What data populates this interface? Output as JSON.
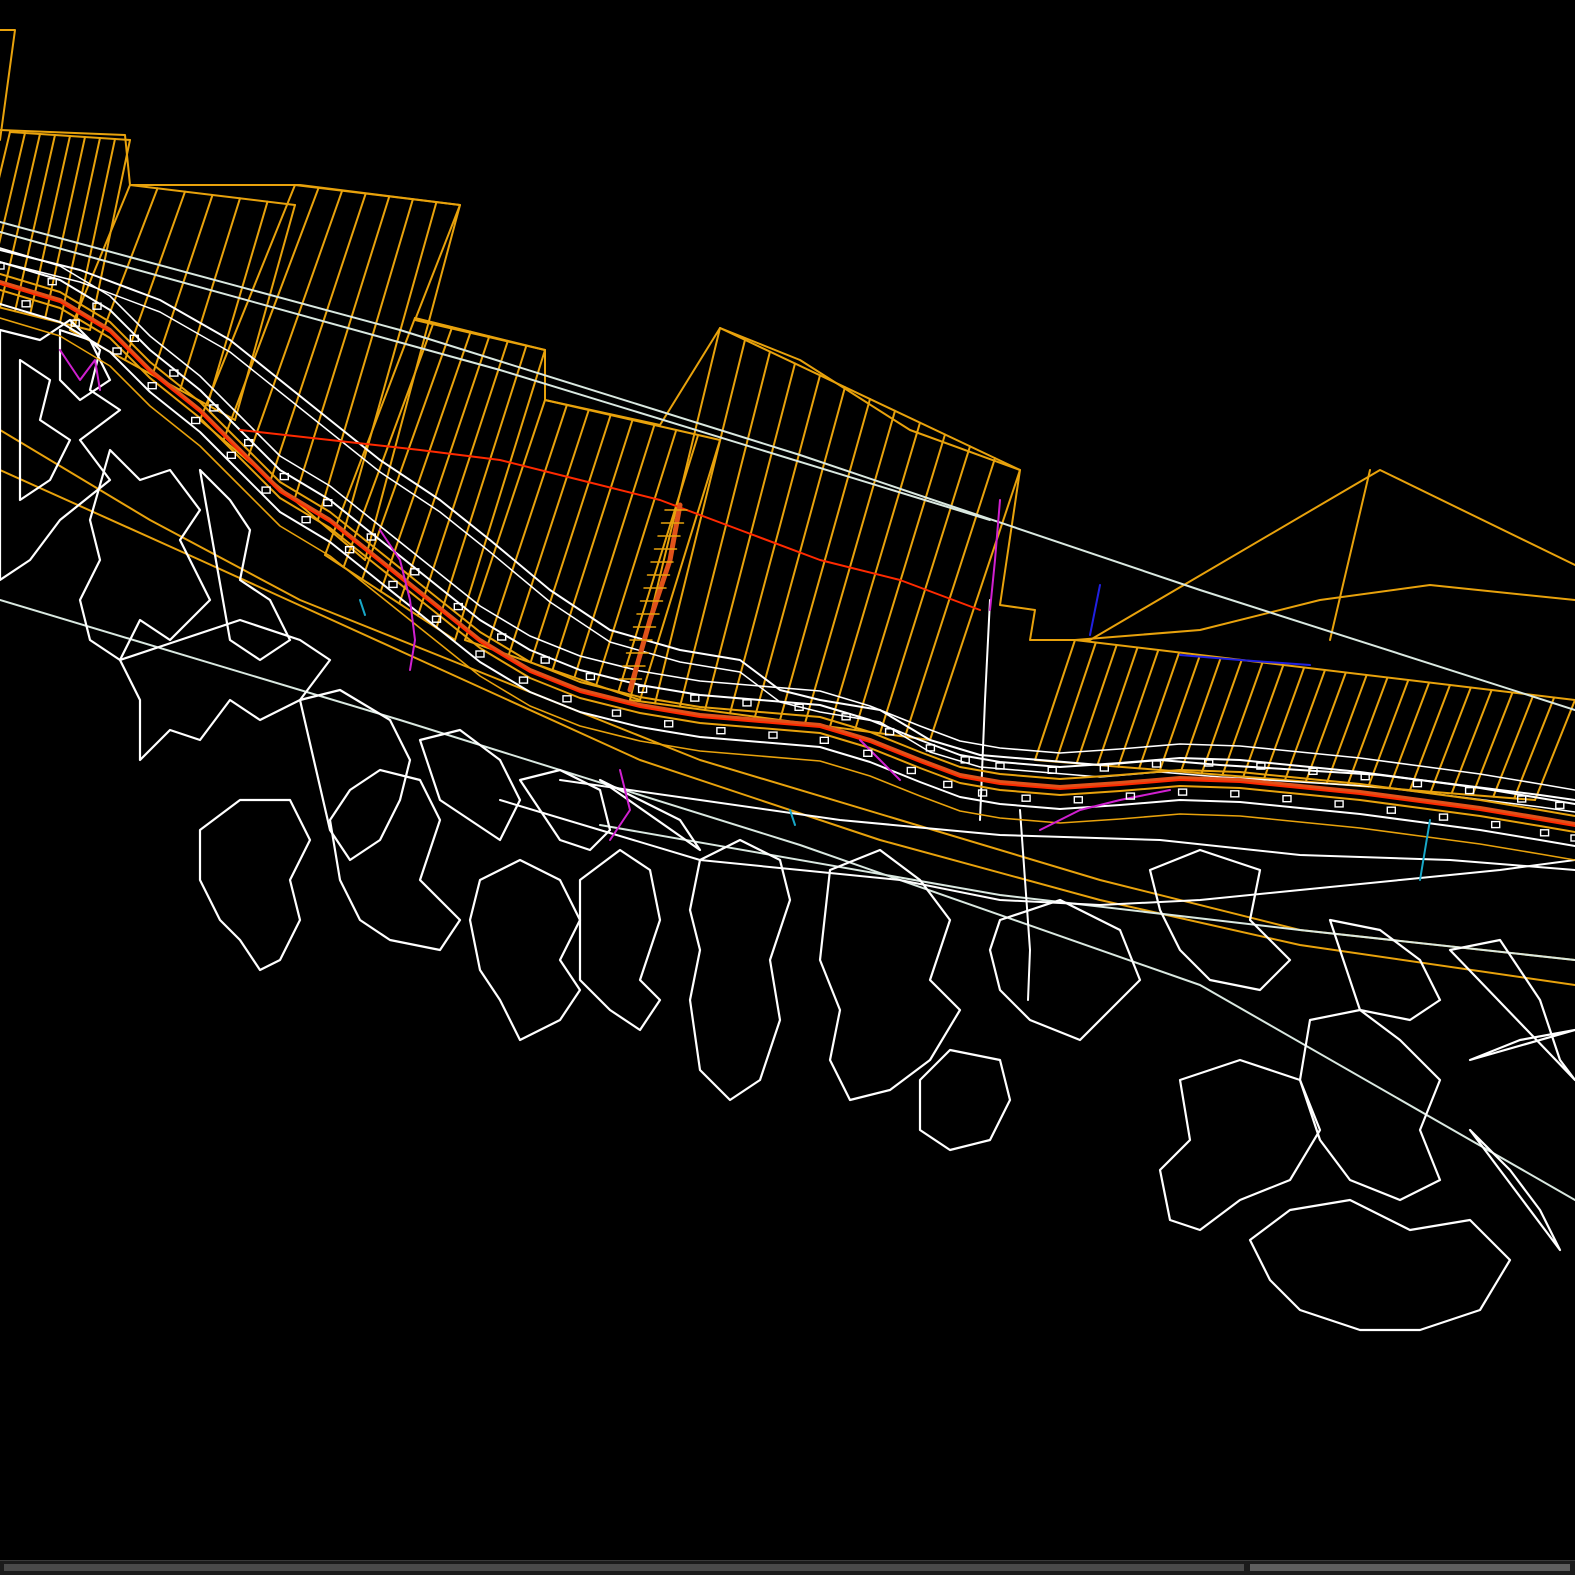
{
  "drawing": {
    "background_color": "#000000",
    "layer_colors": {
      "parcels": "#E8A20C",
      "terrain": "#FFFFFF",
      "road": "#E0521A",
      "road_axis": "#FF2A00",
      "survey_line": "#D9E8E0",
      "drainage": "#D020D0",
      "water": "#2020E0",
      "marker": "#18A8C8"
    }
  },
  "scrollbar": {
    "track_color": "#1b1b1b",
    "thumb_color": "#4a4a4a"
  }
}
